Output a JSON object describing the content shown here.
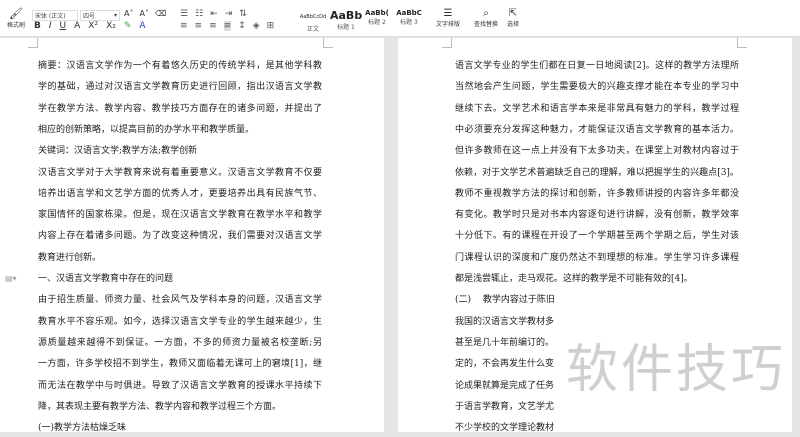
{
  "ribbon": {
    "format_painter": "格式刷",
    "font_name": "宋体 (正文)",
    "font_size": "四号",
    "styles": [
      {
        "preview": "AaBbCcDd",
        "label": "正文"
      },
      {
        "preview": "AaBb",
        "label": "标题 1"
      },
      {
        "preview": "AaBb(",
        "label": "标题 2"
      },
      {
        "preview": "AaBbC",
        "label": "标题 3"
      }
    ],
    "text_layout": "文字排版",
    "find_replace": "查找替换",
    "select": "选择",
    "buttons": [
      "B",
      "I",
      "U",
      "A",
      "X²",
      "X₂"
    ]
  },
  "left_page": {
    "lines": [
      "摘要：汉语言文学作为一个有着悠久历史的传统学科，是其他学科教",
      "学的基础，通过对汉语言文学教育历史进行回顾，指出汉语言文学教",
      "学在教学方法、教学内容、教学技巧方面存在的诸多问题，并提出了",
      "相应的创新策略，以提高目前的办学水平和教学质量。",
      "关键词：汉语言文学;教学方法;教学创新",
      "汉语言文学对于大学教育来说有着重要意义。汉语言文学教育不仅要",
      "培养出语言学和文艺学方面的优秀人才，更要培养出具有民族气节、",
      "家国情怀的国家栋梁。但是，现在汉语言文学教育在教学水平和教学",
      "内容上存在着诸多问题。为了改变这种情况，我们需要对汉语言文学",
      "教育进行创新。",
      "一、汉语言文学教育中存在的问题",
      "由于招生质量、师资力量、社会风气及学科本身的问题，汉语言文学",
      "教育水平不容乐观。如今，选择汉语言文学专业的学生越来越少，生",
      "源质量越来越得不到保证。一方面，不多的师资力量被名校垄断;另",
      "一方面，许多学校招不到学生，教师又面临着无课可上的窘境[1]，继",
      "而无法在教学中与时俱进。导致了汉语言文学教育的授课水平持续下",
      "降，其表现主要有教学方法、教学内容和教学过程三个方面。",
      "(一)教学方法枯燥乏味"
    ]
  },
  "right_page": {
    "lines": [
      "语言文学专业的学生们都在日复一日地阅读[2]。这样的教学方法理所",
      "当然地会产生问题，学生需要极大的兴趣支撑才能在本专业的学习中",
      "继续下去。文学艺术和语言学本来是非常具有魅力的学科，教学过程",
      "中必须要充分发挥这种魅力，才能保证汉语言文学教育的基本活力。",
      "但许多教师在这一点上并没有下太多功夫，在课堂上对教材内容过于",
      "依赖，对于文学艺术普遍缺乏自己的理解，难以把握学生的兴趣点[3]。",
      "教师不重视教学方法的探讨和创新，许多教师讲授的内容许多年都没",
      "有变化。教学时只是对书本内容逐句进行讲解，没有创新，教学效率",
      "十分低下。有的课程在开设了一个学期甚至两个学期之后，学生对该",
      "门课程认识的深度和广度仍然达不到理想的标准。学生学习许多课程",
      "都是浅尝辄止，走马观花。这样的教学是不可能有效的[4]。",
      "(二)　 教学内容过于陈旧",
      "我国的汉语言文学教材多",
      "甚至是几十年前编订的。",
      "定的，不会再发生什么变",
      "论成果就算是完成了任务",
      "于语言学教育，文艺学尤",
      "不少学校的文学理论教材"
    ]
  },
  "watermark": "软件技巧"
}
